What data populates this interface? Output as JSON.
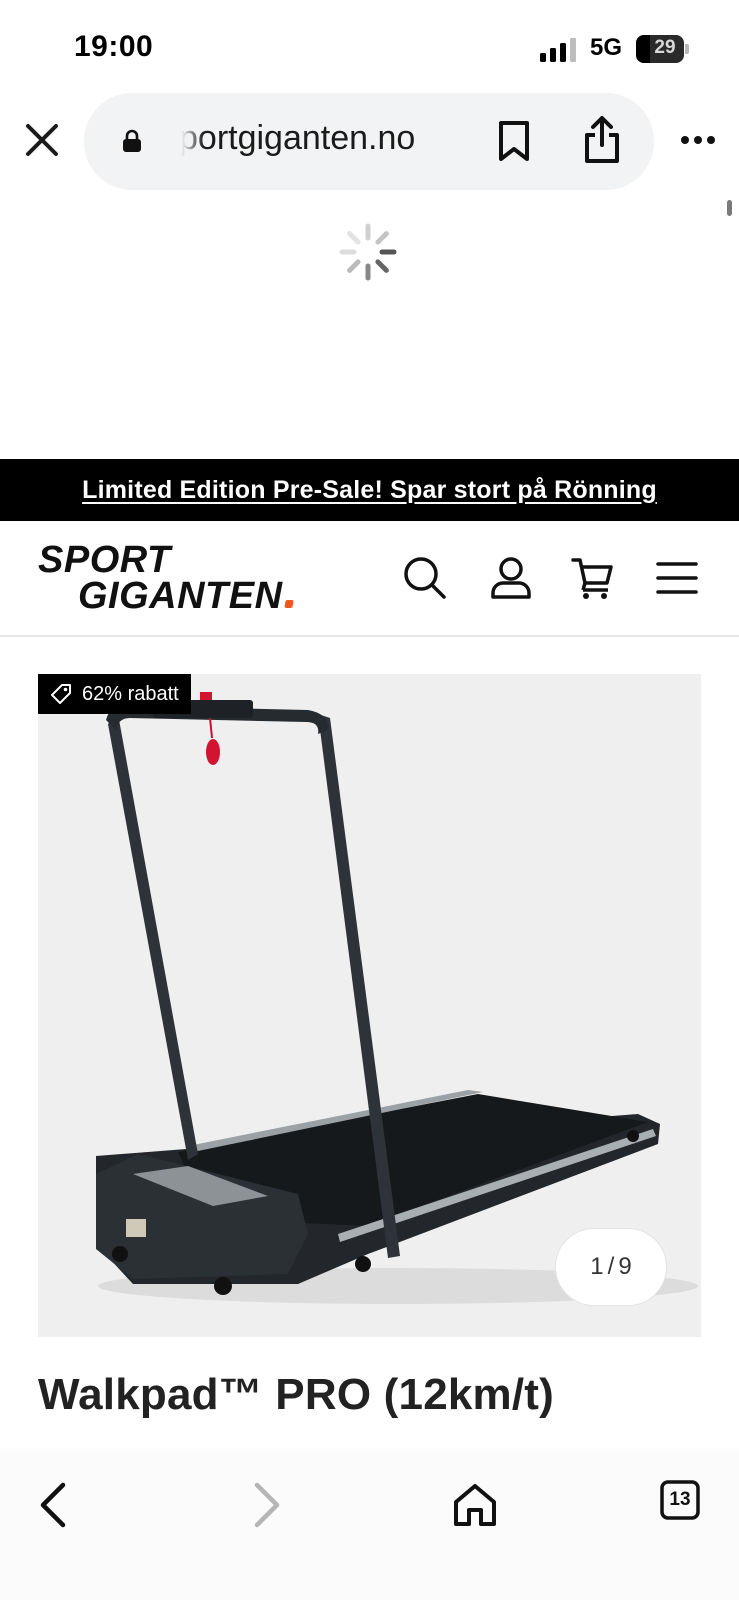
{
  "status_bar": {
    "time": "19:00",
    "network": "5G",
    "battery": "29"
  },
  "browser": {
    "url": "sportgiganten.no",
    "tabs_count": "13"
  },
  "promo": {
    "text": "Limited Edition Pre-Sale! Spar stort på Rönning"
  },
  "header": {
    "logo_line1": "SPORT",
    "logo_line2": "GIGANTEN",
    "accent_color": "#f0561d"
  },
  "product": {
    "discount": "62% rabatt",
    "title": "Walkpad™ PRO (12km/t)",
    "image_index": "1",
    "image_total": "9"
  },
  "icons": [
    "close-icon",
    "lock-icon",
    "bookmark-icon",
    "share-icon",
    "more-icon",
    "spinner-icon",
    "search-icon",
    "account-icon",
    "cart-icon",
    "menu-icon",
    "tag-icon",
    "back-icon",
    "forward-icon",
    "home-icon",
    "tabs-icon"
  ]
}
